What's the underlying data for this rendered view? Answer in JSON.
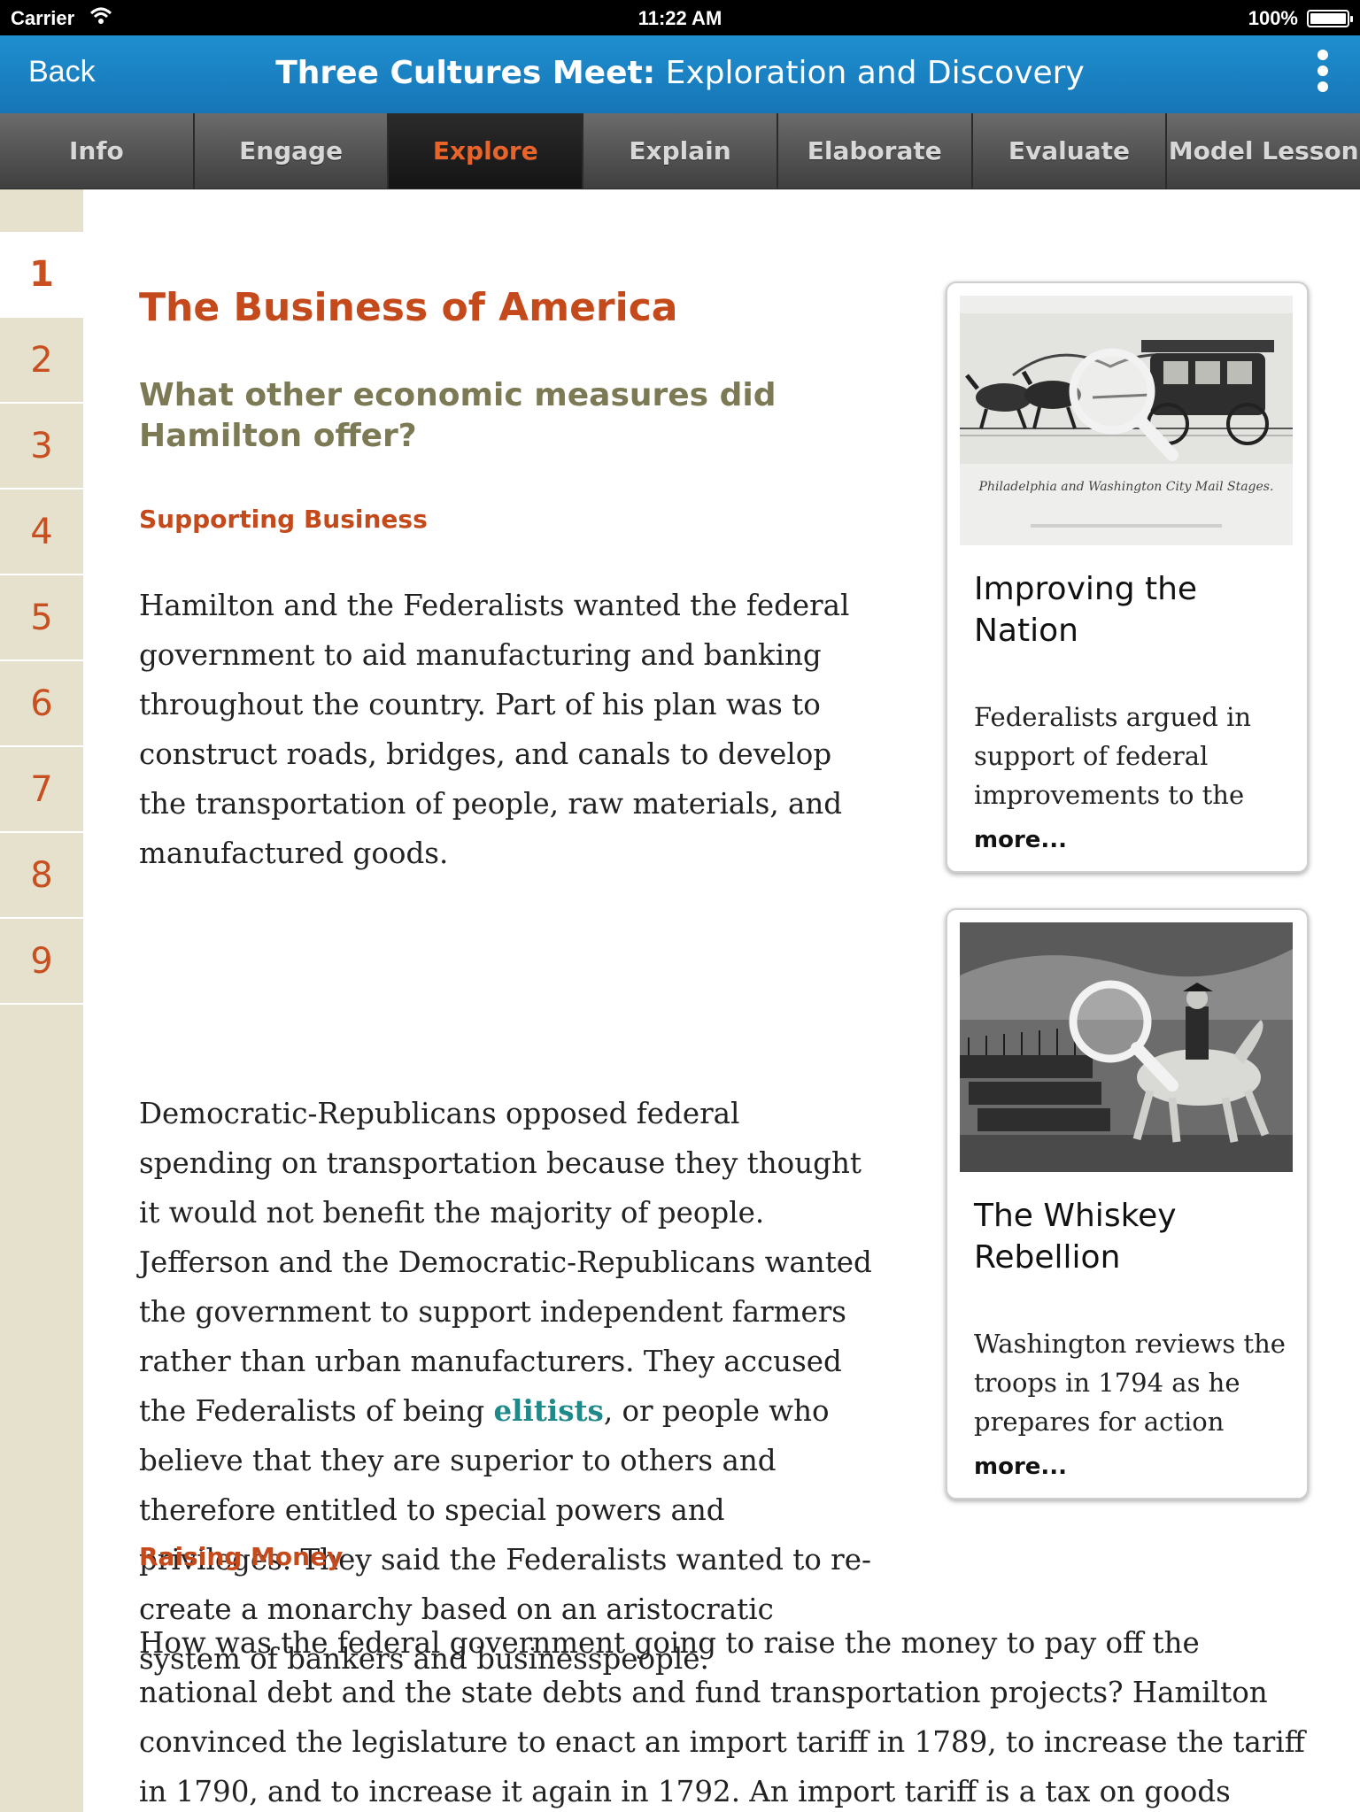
{
  "status_bar": {
    "carrier": "Carrier",
    "time": "11:22 AM",
    "battery": "100%"
  },
  "title_bar": {
    "back_label": "Back",
    "title_bold": "Three Cultures Meet:",
    "title_rest": " Exploration and Discovery"
  },
  "tabs": [
    {
      "label": "Info"
    },
    {
      "label": "Engage"
    },
    {
      "label": "Explore",
      "active": true
    },
    {
      "label": "Explain"
    },
    {
      "label": "Elaborate"
    },
    {
      "label": "Evaluate"
    },
    {
      "label": "Model Lesson"
    }
  ],
  "pages": [
    "1",
    "2",
    "3",
    "4",
    "5",
    "6",
    "7",
    "8",
    "9"
  ],
  "current_page": "1",
  "article": {
    "title": "The Business of America",
    "question": "What other economic measures did Hamilton offer?",
    "section1_heading": "Supporting Business",
    "para1": "Hamilton and the Federalists wanted the federal government to aid manufacturing and banking throughout the country. Part of his plan was to construct roads, bridges, and canals to develop the transportation of people, raw materials, and manufactured goods.",
    "para2_before": "Democratic-Republicans opposed federal spending on transportation because they thought it would not benefit the majority of people. Jefferson and the Democratic-Republicans wanted the government to support independent farmers rather than urban manufacturers. They accused the Federalists of being ",
    "para2_term": "elitists",
    "para2_after": ", or people who believe that they are superior to others and therefore entitled to special powers and privileges. They said the Federalists wanted to re-create a monarchy based on an aristocratic system of bankers and businesspeople.",
    "section2_heading": "Raising Money",
    "para3": "How was the federal government going to raise the money to pay off the national debt and the state debts and fund transportation projects? Hamilton convinced the legislature to enact an import tariff in 1789, to increase the tariff in 1790, and to increase it again in 1792. An import tariff is a tax on goods brought into a country"
  },
  "cards": [
    {
      "caption_in_image": "Philadelphia and Washington City Mail Stages.",
      "title": "Improving the Nation",
      "description": "Federalists argued in support of federal improvements to the",
      "more": "more..."
    },
    {
      "title": "The Whiskey Rebellion",
      "description": "Washington reviews the troops in 1794 as he prepares for action",
      "more": "more..."
    }
  ],
  "colors": {
    "title_bar": "#1a82c4",
    "tab_active_text": "#e8642a",
    "heading": "#c44a1c",
    "question": "#7c7a55",
    "term": "#208a8a",
    "sidebar": "#e5e1cc"
  }
}
